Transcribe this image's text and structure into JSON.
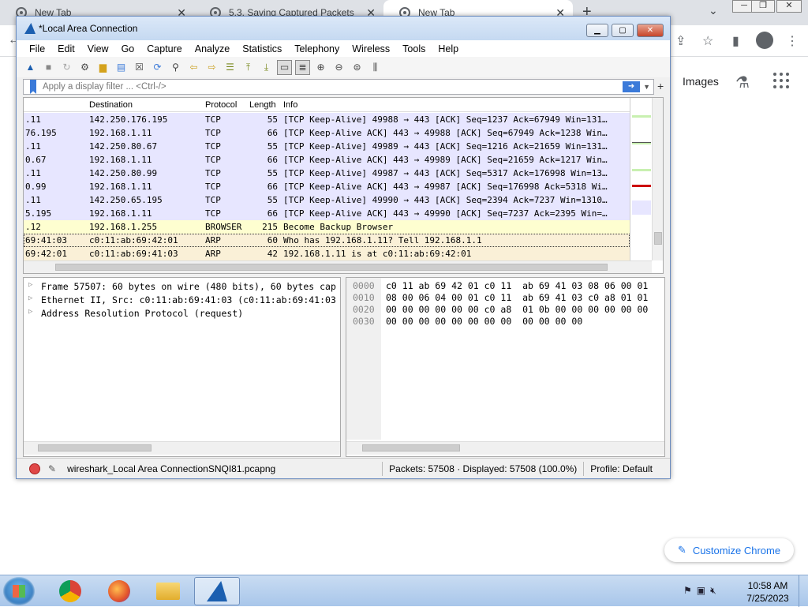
{
  "chrome": {
    "tabs": [
      {
        "title": "New Tab",
        "active": false
      },
      {
        "title": "5.3. Saving Captured Packets",
        "active": false
      },
      {
        "title": "New Tab",
        "active": true
      }
    ],
    "close": "✕",
    "new_tab": "+",
    "tab_search": "⌄",
    "ntp": {
      "images_link": "Images",
      "customize_label": "Customize Chrome"
    }
  },
  "wireshark": {
    "title": "*Local Area Connection",
    "menu": [
      "File",
      "Edit",
      "View",
      "Go",
      "Capture",
      "Analyze",
      "Statistics",
      "Telephony",
      "Wireless",
      "Tools",
      "Help"
    ],
    "filter": {
      "placeholder": "Apply a display filter ... <Ctrl-/>"
    },
    "columns": [
      "Destination",
      "Protocol",
      "Length",
      "Info"
    ],
    "packets": [
      {
        "src": ".11",
        "dst": "142.250.176.195",
        "proto": "TCP",
        "len": "55",
        "info": "[TCP Keep-Alive] 49988 → 443 [ACK] Seq=1237 Ack=67949 Win=131…",
        "type": "tcp"
      },
      {
        "src": "76.195",
        "dst": "192.168.1.11",
        "proto": "TCP",
        "len": "66",
        "info": "[TCP Keep-Alive ACK] 443 → 49988 [ACK] Seq=67949 Ack=1238 Win…",
        "type": "tcp"
      },
      {
        "src": ".11",
        "dst": "142.250.80.67",
        "proto": "TCP",
        "len": "55",
        "info": "[TCP Keep-Alive] 49989 → 443 [ACK] Seq=1216 Ack=21659 Win=131…",
        "type": "tcp"
      },
      {
        "src": "0.67",
        "dst": "192.168.1.11",
        "proto": "TCP",
        "len": "66",
        "info": "[TCP Keep-Alive ACK] 443 → 49989 [ACK] Seq=21659 Ack=1217 Win…",
        "type": "tcp"
      },
      {
        "src": ".11",
        "dst": "142.250.80.99",
        "proto": "TCP",
        "len": "55",
        "info": "[TCP Keep-Alive] 49987 → 443 [ACK] Seq=5317 Ack=176998 Win=13…",
        "type": "tcp"
      },
      {
        "src": "0.99",
        "dst": "192.168.1.11",
        "proto": "TCP",
        "len": "66",
        "info": "[TCP Keep-Alive ACK] 443 → 49987 [ACK] Seq=176998 Ack=5318 Wi…",
        "type": "tcp"
      },
      {
        "src": ".11",
        "dst": "142.250.65.195",
        "proto": "TCP",
        "len": "55",
        "info": "[TCP Keep-Alive] 49990 → 443 [ACK] Seq=2394 Ack=7237 Win=1310…",
        "type": "tcp"
      },
      {
        "src": "5.195",
        "dst": "192.168.1.11",
        "proto": "TCP",
        "len": "66",
        "info": "[TCP Keep-Alive ACK] 443 → 49990 [ACK] Seq=7237 Ack=2395 Win=…",
        "type": "tcp"
      },
      {
        "src": ".12",
        "dst": "192.168.1.255",
        "proto": "BROWSER",
        "len": "215",
        "info": "Become Backup Browser",
        "type": "browser"
      },
      {
        "src": "69:41:03",
        "dst": "c0:11:ab:69:42:01",
        "proto": "ARP",
        "len": "60",
        "info": "Who has 192.168.1.11? Tell 192.168.1.1",
        "type": "arp_sel"
      },
      {
        "src": "69:42:01",
        "dst": "c0:11:ab:69:41:03",
        "proto": "ARP",
        "len": "42",
        "info": "192.168.1.11 is at c0:11:ab:69:42:01",
        "type": "arp"
      }
    ],
    "details": [
      "Frame 57507: 60 bytes on wire (480 bits), 60 bytes cap",
      "Ethernet II, Src: c0:11:ab:69:41:03 (c0:11:ab:69:41:03",
      "Address Resolution Protocol (request)"
    ],
    "bytes": [
      {
        "offset": "0000",
        "hex": "c0 11 ab 69 42 01 c0 11  ab 69 41 03 08 06 00 01"
      },
      {
        "offset": "0010",
        "hex": "08 00 06 04 00 01 c0 11  ab 69 41 03 c0 a8 01 01"
      },
      {
        "offset": "0020",
        "hex": "00 00 00 00 00 00 c0 a8  01 0b 00 00 00 00 00 00"
      },
      {
        "offset": "0030",
        "hex": "00 00 00 00 00 00 00 00  00 00 00 00"
      }
    ],
    "status": {
      "file": "wireshark_Local Area ConnectionSNQI81.pcapng",
      "packets": "Packets: 57508 · Displayed: 57508 (100.0%)",
      "profile": "Profile: Default"
    }
  },
  "taskbar": {
    "time": "10:58 AM",
    "date": "7/25/2023"
  },
  "colors": {
    "tcp_row": "#e7e6ff",
    "browser_row": "#fefed0",
    "arp_row": "#faf0d7"
  }
}
